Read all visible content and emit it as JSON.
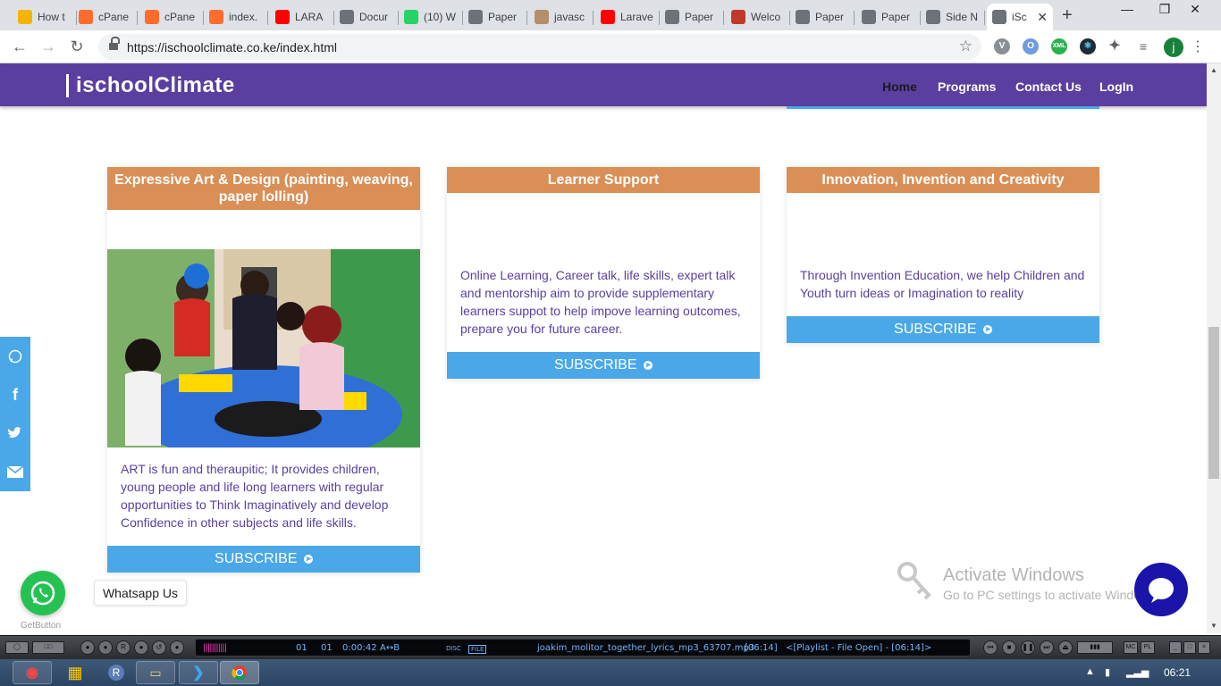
{
  "browser": {
    "tabs": [
      {
        "label": "How t",
        "icon": "folder-icon",
        "color": "#f5b400"
      },
      {
        "label": "cPane",
        "icon": "cpanel-icon",
        "color": "#ff6c2c"
      },
      {
        "label": "cPane",
        "icon": "cpanel-icon",
        "color": "#ff6c2c"
      },
      {
        "label": "index.",
        "icon": "cpanel-icon",
        "color": "#ff6c2c"
      },
      {
        "label": "LARA",
        "icon": "youtube-icon",
        "color": "#ff0000"
      },
      {
        "label": "Docur",
        "icon": "globe-icon",
        "color": "#6d7278"
      },
      {
        "label": "(10) W",
        "icon": "whatsapp-icon",
        "color": "#25d366"
      },
      {
        "label": "Paper",
        "icon": "globe-icon",
        "color": "#6d7278"
      },
      {
        "label": "javasc",
        "icon": "page-icon",
        "color": "#b58e6a"
      },
      {
        "label": "Larave",
        "icon": "youtube-icon",
        "color": "#ff0000"
      },
      {
        "label": "Paper",
        "icon": "globe-icon",
        "color": "#6d7278"
      },
      {
        "label": "Welco",
        "icon": "africa-icon",
        "color": "#c0392b"
      },
      {
        "label": "Paper",
        "icon": "globe-icon",
        "color": "#6d7278"
      },
      {
        "label": "Paper",
        "icon": "globe-icon",
        "color": "#6d7278"
      },
      {
        "label": "Side N",
        "icon": "globe-icon",
        "color": "#6d7278"
      },
      {
        "label": "iSc",
        "icon": "globe-icon",
        "color": "#6d7278",
        "active": true
      }
    ],
    "new_tab": "+",
    "url": "https://ischoolclimate.co.ke/index.html",
    "profile_initial": "j"
  },
  "site": {
    "brand": "ischoolClimate",
    "nav": [
      "Home",
      "Programs",
      "Contact Us",
      "LogIn"
    ]
  },
  "cards": [
    {
      "title": "Expressive Art & Design (painting, weaving, paper lolling)",
      "text": "ART is fun and theraupitic; It provides children, young people and life long learners with regular opportunities to Think Imaginatively and develop Confidence in other subjects and life skills.",
      "button": "SUBSCRIBE"
    },
    {
      "title": "Learner Support",
      "text": "Online Learning, Career talk, life skills, expert talk and mentorship aim to provide supplementary learners suppot to help impove learning outcomes, prepare you for future career.",
      "button": "SUBSCRIBE"
    },
    {
      "title": "Innovation, Invention and Creativity",
      "text": "Through Invention Education, we help Children and Youth turn ideas or Imagination to reality",
      "button": "SUBSCRIBE"
    }
  ],
  "widgets": {
    "whatsapp_label": "Whatsapp Us",
    "getbutton": "GetButton",
    "activate_title": "Activate Windows",
    "activate_sub": "Go to PC settings to activate Windows."
  },
  "player": {
    "track": "01",
    "index": "01",
    "time": "0:00:42",
    "ab": "A↔B",
    "disc": "DISC",
    "file": "FILE",
    "title": "joakim_molitor_together_lyrics_mp3_63707.mp3",
    "duration": "[06:14]",
    "playlist": "<[Playlist - File Open] - [06:14]>"
  },
  "taskbar": {
    "clock": "06:21"
  },
  "colors": {
    "header": "#5b3fa0",
    "card_head": "#d98f55",
    "button": "#4aa8e8",
    "text": "#5b3fa0"
  }
}
